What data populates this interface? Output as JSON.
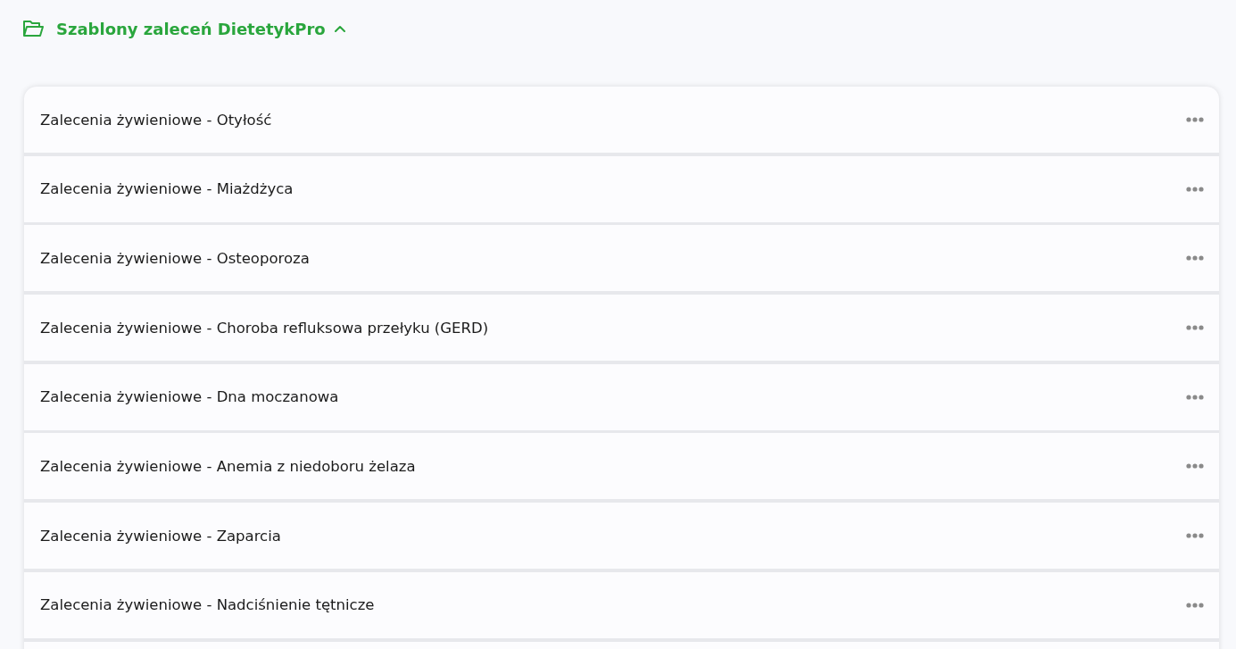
{
  "header": {
    "title": "Szablony zaleceń DietetykPro",
    "expanded": true
  },
  "templates": [
    {
      "title": "Zalecenia żywieniowe - Otyłość"
    },
    {
      "title": "Zalecenia żywieniowe - Miażdżyca"
    },
    {
      "title": "Zalecenia żywieniowe - Osteoporoza"
    },
    {
      "title": "Zalecenia żywieniowe - Choroba refluksowa przełyku (GERD)"
    },
    {
      "title": "Zalecenia żywieniowe - Dna moczanowa"
    },
    {
      "title": "Zalecenia żywieniowe - Anemia z niedoboru żelaza"
    },
    {
      "title": "Zalecenia żywieniowe - Zaparcia"
    },
    {
      "title": "Zalecenia żywieniowe - Nadciśnienie tętnicze"
    }
  ]
}
